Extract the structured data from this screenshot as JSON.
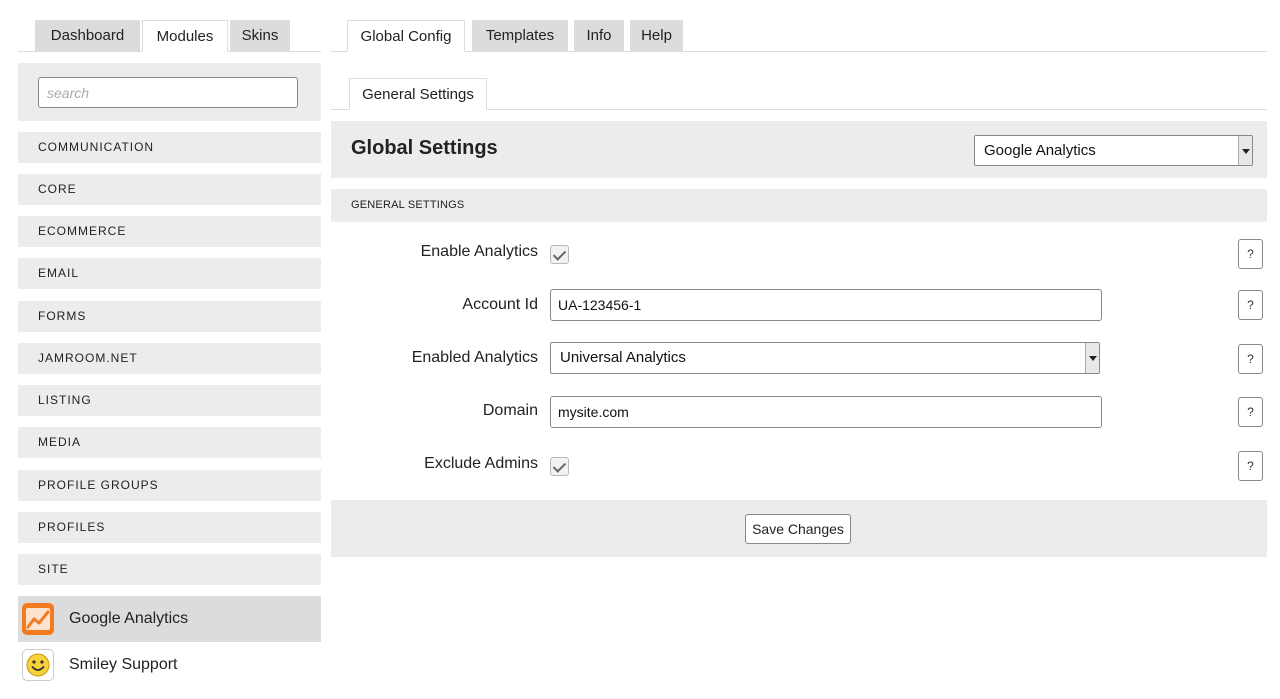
{
  "left_tabs": [
    "Dashboard",
    "Modules",
    "Skins"
  ],
  "right_tabs": [
    "Global Config",
    "Templates",
    "Info",
    "Help"
  ],
  "sub_tab": "General Settings",
  "search": {
    "placeholder": "search",
    "value": ""
  },
  "categories": [
    "COMMUNICATION",
    "CORE",
    "ECOMMERCE",
    "EMAIL",
    "FORMS",
    "JAMROOM.NET",
    "LISTING",
    "MEDIA",
    "PROFILE GROUPS",
    "PROFILES",
    "SITE"
  ],
  "modules": [
    "Google Analytics",
    "Smiley Support"
  ],
  "header": {
    "title": "Global Settings",
    "module_select": "Google Analytics"
  },
  "section": {
    "title": "GENERAL SETTINGS"
  },
  "fields": {
    "enable_analytics": {
      "label": "Enable Analytics",
      "checked": true
    },
    "account_id": {
      "label": "Account Id",
      "value": "UA-123456-1"
    },
    "enabled_analytics": {
      "label": "Enabled Analytics",
      "value": "Universal Analytics"
    },
    "domain": {
      "label": "Domain",
      "value": "mysite.com"
    },
    "exclude_admins": {
      "label": "Exclude Admins",
      "checked": true
    }
  },
  "help_label": "?",
  "save_label": "Save Changes",
  "colors": {
    "panel_bg": "#ececec",
    "active_bg": "#dcdcdc",
    "analytics_icon": "#f47a20",
    "smiley_icon": "#f7d23b"
  }
}
